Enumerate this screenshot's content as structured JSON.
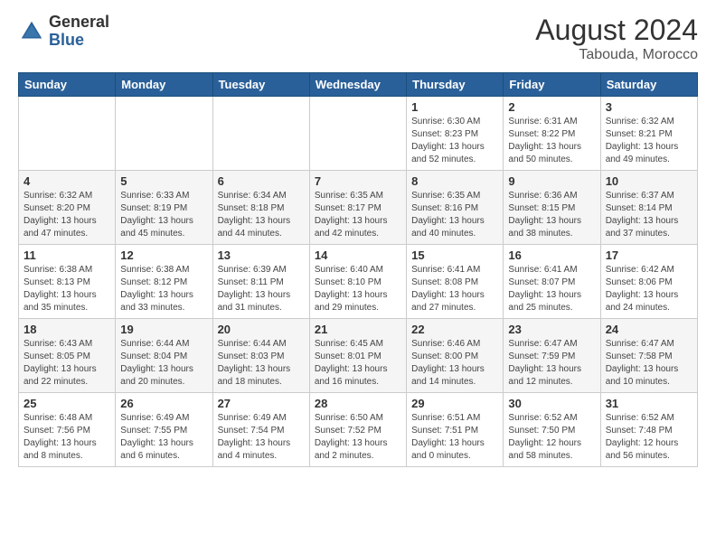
{
  "header": {
    "logo_general": "General",
    "logo_blue": "Blue",
    "month_year": "August 2024",
    "location": "Tabouda, Morocco"
  },
  "weekdays": [
    "Sunday",
    "Monday",
    "Tuesday",
    "Wednesday",
    "Thursday",
    "Friday",
    "Saturday"
  ],
  "weeks": [
    [
      {
        "day": "",
        "info": ""
      },
      {
        "day": "",
        "info": ""
      },
      {
        "day": "",
        "info": ""
      },
      {
        "day": "",
        "info": ""
      },
      {
        "day": "1",
        "info": "Sunrise: 6:30 AM\nSunset: 8:23 PM\nDaylight: 13 hours\nand 52 minutes."
      },
      {
        "day": "2",
        "info": "Sunrise: 6:31 AM\nSunset: 8:22 PM\nDaylight: 13 hours\nand 50 minutes."
      },
      {
        "day": "3",
        "info": "Sunrise: 6:32 AM\nSunset: 8:21 PM\nDaylight: 13 hours\nand 49 minutes."
      }
    ],
    [
      {
        "day": "4",
        "info": "Sunrise: 6:32 AM\nSunset: 8:20 PM\nDaylight: 13 hours\nand 47 minutes."
      },
      {
        "day": "5",
        "info": "Sunrise: 6:33 AM\nSunset: 8:19 PM\nDaylight: 13 hours\nand 45 minutes."
      },
      {
        "day": "6",
        "info": "Sunrise: 6:34 AM\nSunset: 8:18 PM\nDaylight: 13 hours\nand 44 minutes."
      },
      {
        "day": "7",
        "info": "Sunrise: 6:35 AM\nSunset: 8:17 PM\nDaylight: 13 hours\nand 42 minutes."
      },
      {
        "day": "8",
        "info": "Sunrise: 6:35 AM\nSunset: 8:16 PM\nDaylight: 13 hours\nand 40 minutes."
      },
      {
        "day": "9",
        "info": "Sunrise: 6:36 AM\nSunset: 8:15 PM\nDaylight: 13 hours\nand 38 minutes."
      },
      {
        "day": "10",
        "info": "Sunrise: 6:37 AM\nSunset: 8:14 PM\nDaylight: 13 hours\nand 37 minutes."
      }
    ],
    [
      {
        "day": "11",
        "info": "Sunrise: 6:38 AM\nSunset: 8:13 PM\nDaylight: 13 hours\nand 35 minutes."
      },
      {
        "day": "12",
        "info": "Sunrise: 6:38 AM\nSunset: 8:12 PM\nDaylight: 13 hours\nand 33 minutes."
      },
      {
        "day": "13",
        "info": "Sunrise: 6:39 AM\nSunset: 8:11 PM\nDaylight: 13 hours\nand 31 minutes."
      },
      {
        "day": "14",
        "info": "Sunrise: 6:40 AM\nSunset: 8:10 PM\nDaylight: 13 hours\nand 29 minutes."
      },
      {
        "day": "15",
        "info": "Sunrise: 6:41 AM\nSunset: 8:08 PM\nDaylight: 13 hours\nand 27 minutes."
      },
      {
        "day": "16",
        "info": "Sunrise: 6:41 AM\nSunset: 8:07 PM\nDaylight: 13 hours\nand 25 minutes."
      },
      {
        "day": "17",
        "info": "Sunrise: 6:42 AM\nSunset: 8:06 PM\nDaylight: 13 hours\nand 24 minutes."
      }
    ],
    [
      {
        "day": "18",
        "info": "Sunrise: 6:43 AM\nSunset: 8:05 PM\nDaylight: 13 hours\nand 22 minutes."
      },
      {
        "day": "19",
        "info": "Sunrise: 6:44 AM\nSunset: 8:04 PM\nDaylight: 13 hours\nand 20 minutes."
      },
      {
        "day": "20",
        "info": "Sunrise: 6:44 AM\nSunset: 8:03 PM\nDaylight: 13 hours\nand 18 minutes."
      },
      {
        "day": "21",
        "info": "Sunrise: 6:45 AM\nSunset: 8:01 PM\nDaylight: 13 hours\nand 16 minutes."
      },
      {
        "day": "22",
        "info": "Sunrise: 6:46 AM\nSunset: 8:00 PM\nDaylight: 13 hours\nand 14 minutes."
      },
      {
        "day": "23",
        "info": "Sunrise: 6:47 AM\nSunset: 7:59 PM\nDaylight: 13 hours\nand 12 minutes."
      },
      {
        "day": "24",
        "info": "Sunrise: 6:47 AM\nSunset: 7:58 PM\nDaylight: 13 hours\nand 10 minutes."
      }
    ],
    [
      {
        "day": "25",
        "info": "Sunrise: 6:48 AM\nSunset: 7:56 PM\nDaylight: 13 hours\nand 8 minutes."
      },
      {
        "day": "26",
        "info": "Sunrise: 6:49 AM\nSunset: 7:55 PM\nDaylight: 13 hours\nand 6 minutes."
      },
      {
        "day": "27",
        "info": "Sunrise: 6:49 AM\nSunset: 7:54 PM\nDaylight: 13 hours\nand 4 minutes."
      },
      {
        "day": "28",
        "info": "Sunrise: 6:50 AM\nSunset: 7:52 PM\nDaylight: 13 hours\nand 2 minutes."
      },
      {
        "day": "29",
        "info": "Sunrise: 6:51 AM\nSunset: 7:51 PM\nDaylight: 13 hours\nand 0 minutes."
      },
      {
        "day": "30",
        "info": "Sunrise: 6:52 AM\nSunset: 7:50 PM\nDaylight: 12 hours\nand 58 minutes."
      },
      {
        "day": "31",
        "info": "Sunrise: 6:52 AM\nSunset: 7:48 PM\nDaylight: 12 hours\nand 56 minutes."
      }
    ]
  ]
}
